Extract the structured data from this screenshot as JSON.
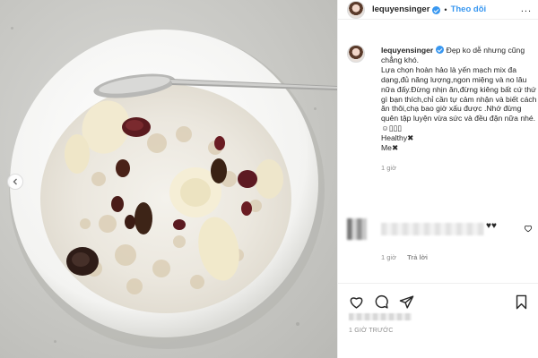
{
  "header": {
    "username": "lequyensinger",
    "separator": "•",
    "follow_label": "Theo dõi",
    "more_label": "..."
  },
  "caption": {
    "username": "lequyensinger",
    "text": "Đẹp ko dễ nhưng cũng chẳng khó.\nLựa chọn hoàn hảo là yến mạch mix đa dạng,đủ năng lượng,ngon miệng và no lâu nữa đấy.Đừng nhịn ăn,đừng kiêng bất cứ thứ gì bạn thích,chỉ cần tự cảm nhận và biết cách ăn thôi,chạ bao giờ xấu được .Nhớ đừng quên tập luyện vừa sức và đều đặn nữa nhé.\n☺▯▯▯\nHealthy✖\nMe✖",
    "time": "1 giờ"
  },
  "comment": {
    "hearts": "♥♥",
    "time": "1 giờ",
    "reply_label": "Trả lời"
  },
  "footer": {
    "post_time": "1 GIỜ TRƯỚC"
  },
  "icons": {
    "prev": "chevron-left-icon",
    "like": "heart-icon",
    "comment": "comment-icon",
    "share": "share-icon",
    "save": "bookmark-icon"
  },
  "colors": {
    "accent": "#3897f0",
    "text": "#262626",
    "muted": "#8e8e8e"
  }
}
